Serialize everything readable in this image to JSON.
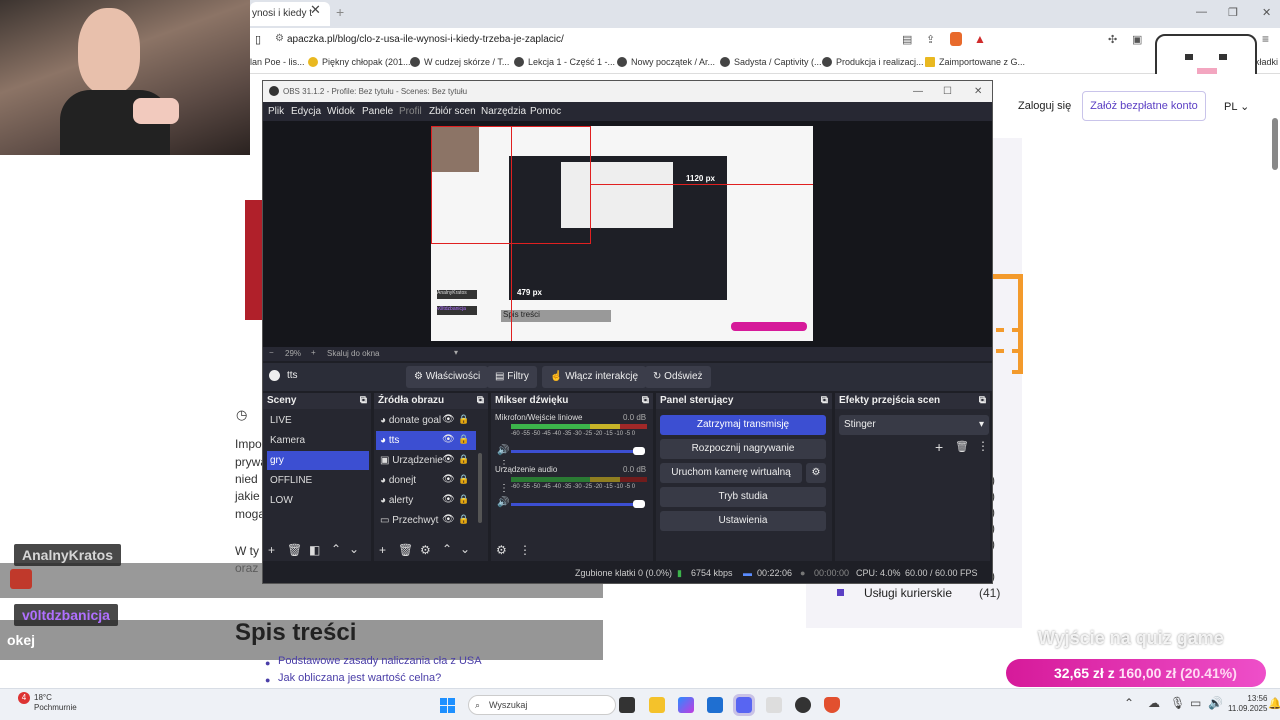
{
  "browser": {
    "active_tab_title": "ynosi i kiedy t",
    "url": "apaczka.pl/blog/clo-z-usa-ile-wynosi-i-kiedy-trzeba-je-zaplacic/",
    "bookmarks": [
      "lan Poe - lis...",
      "Piękny chłopak (201...",
      "W cudzej skórze / T...",
      "Lekcja 1 - Część 1 -...",
      "Nowy początek / Ar...",
      "Sadysta / Captivity (...",
      "Produkcja i realizacj...",
      "Zaimportowane z G..."
    ],
    "bookmarks_right": "akładki"
  },
  "site": {
    "login": "Zaloguj się",
    "signup": "Załóż bezpłatne konto",
    "lang": "PL"
  },
  "article": {
    "fragments": [
      "Impo",
      "prywa",
      "nied",
      "jakie",
      "mogą"
    ],
    "para2_a": "W ty",
    "para2_b": "oraz",
    "toc_title": "Spis treści",
    "toc_items": [
      "Podstawowe zasady naliczania cła z USA",
      "Jak obliczana jest wartość celna?"
    ]
  },
  "sidebar": {
    "counts": [
      ")",
      ")",
      ")",
      ")",
      ")",
      ")"
    ],
    "last_category": "Usługi kurierskie",
    "last_count": "(41)"
  },
  "chat": {
    "user1": "AnalnyKratos",
    "user2": "v0ltdzbanicja",
    "message2": "okej",
    "user1_color": "#d6d6d6",
    "user2_color": "#b070ff"
  },
  "obs": {
    "title": "OBS 31.1.2 - Profile: Bez tytułu - Scenes: Bez tytułu",
    "menu": [
      "Plik",
      "Edycja",
      "Widok",
      "Panele",
      "Profil",
      "Zbiór scen",
      "Narzędzia",
      "Pomoc"
    ],
    "zoom": "29%",
    "zoom_mode": "Skaluj do okna",
    "preview_label_w": "1120 px",
    "preview_label_h": "479 px",
    "preview_toc": "Spis treści",
    "selected_source": "tts",
    "toolbar": {
      "properties": "Właściwości",
      "filters": "Filtry",
      "interact": "Włącz interakcję",
      "refresh": "Odśwież"
    },
    "scenes_title": "Sceny",
    "scenes": [
      "LIVE",
      "Kamera",
      "gry",
      "OFFLINE",
      "LOW"
    ],
    "active_scene_index": 2,
    "sources_title": "Źródła obrazu",
    "sources": [
      "donate goal",
      "tts",
      "Urządzenie",
      "donejt",
      "alerty",
      "Przechwyt"
    ],
    "mixer_title": "Mikser dźwięku",
    "mixer": [
      {
        "name": "Mikrofon/Wejście liniowe",
        "db": "0.0 dB"
      },
      {
        "name": "Urządzenie audio",
        "db": "0.0 dB"
      }
    ],
    "meter_scale": "-60 -55 -50 -45 -40 -35 -30 -25 -20 -15 -10 -5 0",
    "controls_title": "Panel sterujący",
    "controls": [
      "Zatrzymaj transmisję",
      "Rozpocznij nagrywanie",
      "Uruchom kamerę wirtualną",
      "Tryb studia",
      "Ustawienia"
    ],
    "transitions_title": "Efekty przejścia scen",
    "transition": "Stinger",
    "status": {
      "dropped": "Zgubione klatki 0 (0.0%)",
      "bitrate": "6754 kbps",
      "stream_time": "00:22:06",
      "rec_time": "00:00:00",
      "cpu": "CPU: 4.0%",
      "fps": "60.00 / 60.00 FPS"
    },
    "accent": "#3c4fd2"
  },
  "overlay": {
    "quiz": "Wyjście na quiz game",
    "amount": "32,65 zł",
    "sep": "z",
    "goal": "160,00 zł",
    "pct": "(20.41%)",
    "progress": 0.2041
  },
  "taskbar": {
    "temp": "18°C",
    "weather": "Pochmurnie",
    "badge": "4",
    "search": "Wyszukaj",
    "time": "13:56",
    "date": "11.09.2025"
  }
}
